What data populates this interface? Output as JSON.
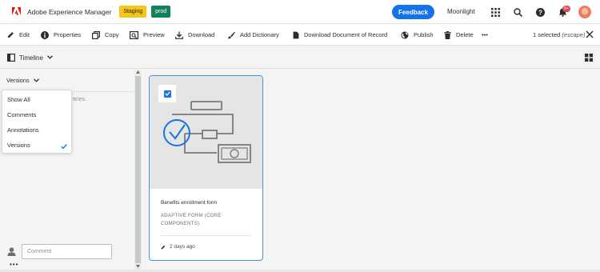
{
  "header": {
    "app_title": "Adobe Experience Manager",
    "env_staging": "Staging",
    "env_prod": "prod",
    "feedback_label": "Feedback",
    "org_name": "Moonlight",
    "notification_count": "9+",
    "icons": [
      "adobe-logo-icon",
      "apps-grid-icon",
      "search-icon",
      "help-icon",
      "bell-icon",
      "user-avatar"
    ]
  },
  "actions": {
    "edit": "Edit",
    "properties": "Properties",
    "copy": "Copy",
    "preview": "Preview",
    "download": "Download",
    "add_dictionary": "Add Dictionary",
    "download_dor": "Download Document of Record",
    "publish": "Publish",
    "delete": "Delete",
    "more": "•••",
    "selection_count": "1 selected",
    "escape_hint": "(escape)"
  },
  "rail": {
    "title": "Timeline"
  },
  "timeline": {
    "filter_label": "Versions",
    "empty_text_partial": "ntries.",
    "options": [
      "Show All",
      "Comments",
      "Annotations",
      "Versions"
    ],
    "selected_option": "Versions",
    "comment_placeholder": "Comment",
    "more": "•••"
  },
  "card": {
    "title": "Benefits enrollment form",
    "type": "ADAPTIVE FORM (CORE COMPONENTS)",
    "modified": "2 days ago",
    "selected": true
  },
  "colors": {
    "accent": "#1473e6",
    "adobe_red": "#eb1000",
    "staging_badge": "#f5c518",
    "prod_badge": "#12805c"
  }
}
